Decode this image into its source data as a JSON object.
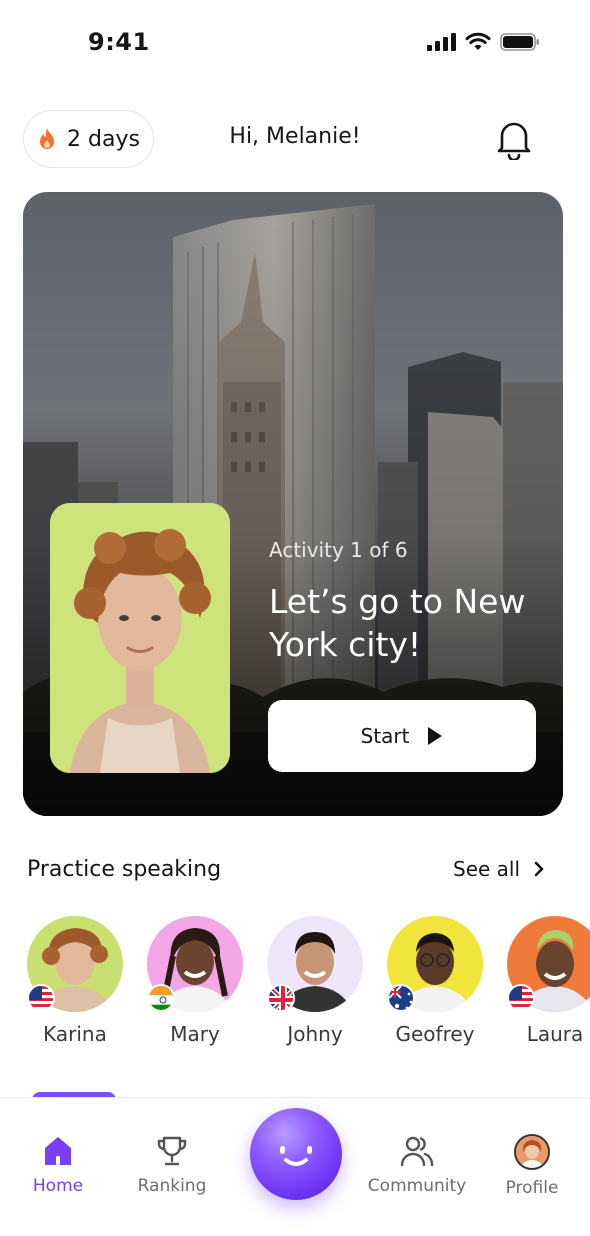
{
  "status_bar": {
    "time": "9:41"
  },
  "header": {
    "streak_label": "2 days",
    "greeting": "Hi, Melanie!"
  },
  "hero": {
    "activity_label": "Activity 1 of 6",
    "title": "Let’s go to New York city!",
    "start_label": "Start"
  },
  "practice": {
    "title": "Practice speaking",
    "see_all_label": "See all",
    "speakers": [
      {
        "name": "Karina",
        "flag": "us-flag",
        "bg": "#c9df72"
      },
      {
        "name": "Mary",
        "flag": "india-flag",
        "bg": "#f3a6e6"
      },
      {
        "name": "Johny",
        "flag": "uk-flag",
        "bg": "#ece6f8"
      },
      {
        "name": "Geofrey",
        "flag": "australia-flag",
        "bg": "#f1e43a"
      },
      {
        "name": "Laura",
        "flag": "us-flag",
        "bg": "#f07a3a"
      }
    ]
  },
  "nav": {
    "home": "Home",
    "ranking": "Ranking",
    "community": "Community",
    "profile": "Profile"
  },
  "colors": {
    "accent": "#7b3ff2",
    "streak": "#f2722b"
  }
}
